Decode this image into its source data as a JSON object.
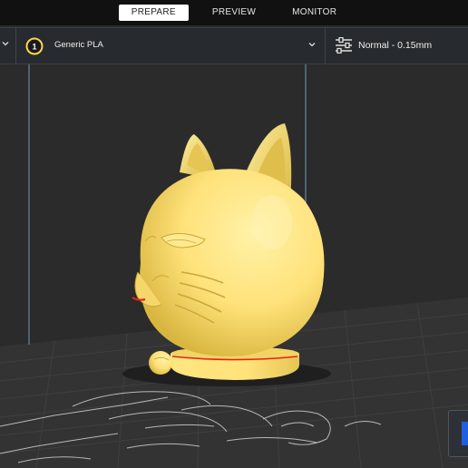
{
  "header": {
    "tabs": [
      {
        "label": "PREPARE",
        "active": true
      },
      {
        "label": "PREVIEW",
        "active": false
      },
      {
        "label": "MONITOR",
        "active": false
      }
    ]
  },
  "toolbar": {
    "extruder_number": "1",
    "material_label": "Generic PLA",
    "profile_label": "Normal - 0.15mm"
  },
  "colors": {
    "model": "#ffe27a",
    "overhang": "#e8221b",
    "accent": "#1f5fe0",
    "bed": "#323232"
  },
  "icons": [
    "chevron-down-icon",
    "extruder-icon",
    "settings-sliders-icon"
  ]
}
